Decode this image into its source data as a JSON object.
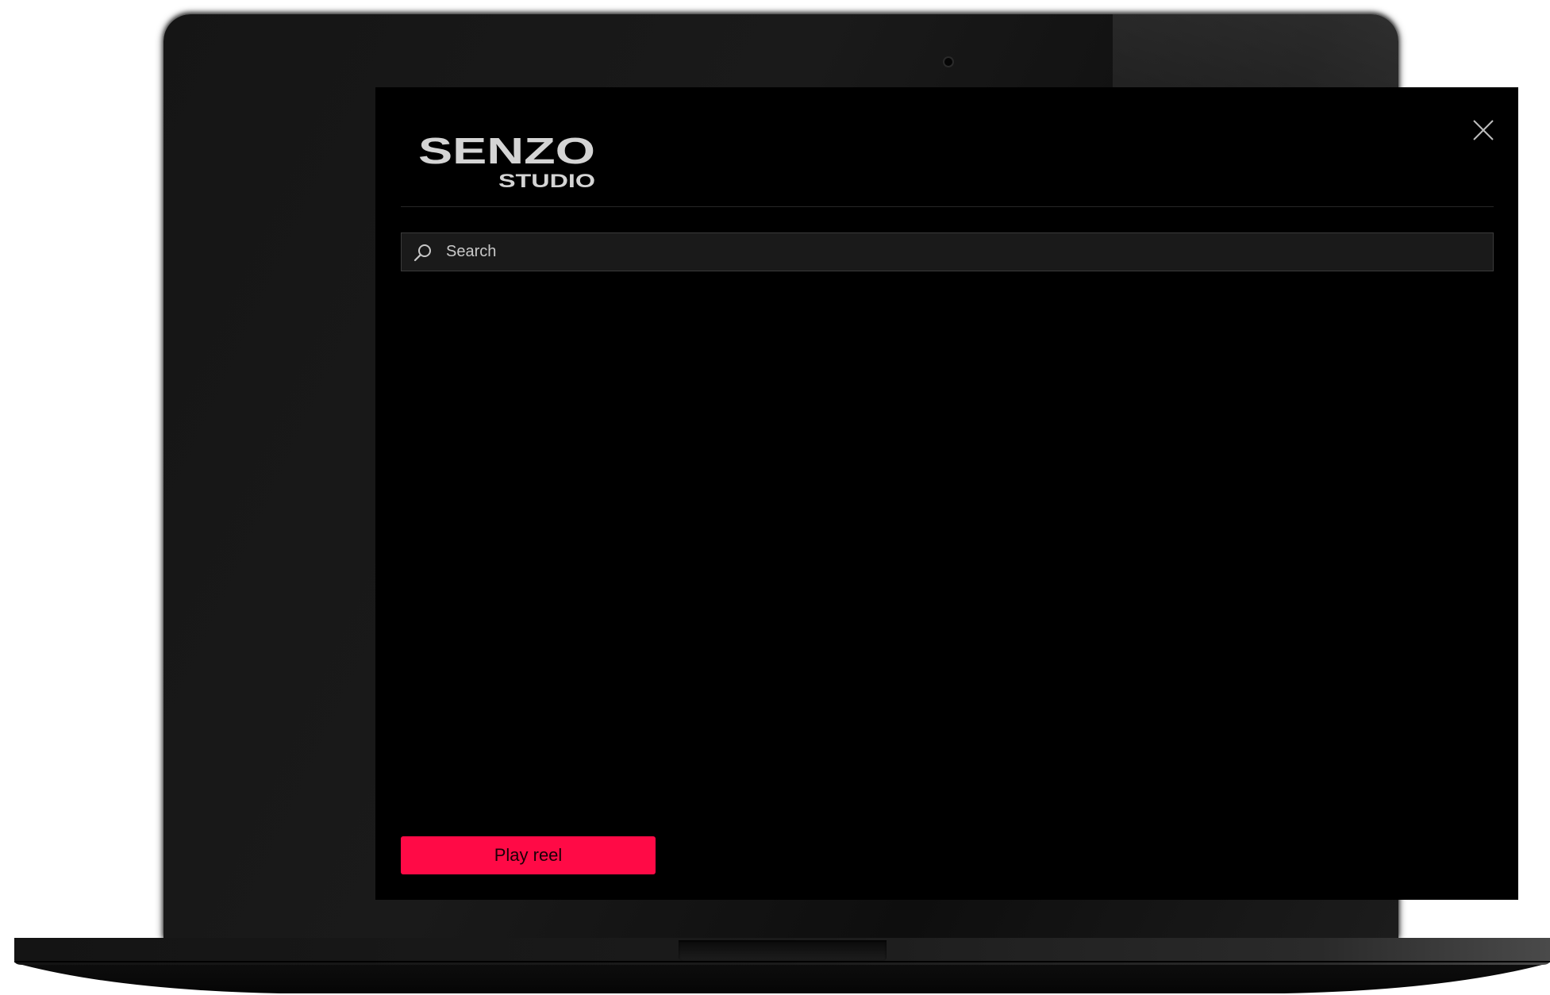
{
  "app": {
    "logo_main": "SENZO",
    "logo_sub": "STUDIO"
  },
  "header": {
    "close_icon": "close-icon"
  },
  "search": {
    "placeholder": "Search",
    "value": "",
    "icon": "search-icon"
  },
  "actions": {
    "play_reel_label": "Play reel"
  },
  "colors": {
    "background": "#000000",
    "accent": "#ff0a46",
    "search_field": "#1a1a1a",
    "logo_text": "#d4d4d4"
  }
}
